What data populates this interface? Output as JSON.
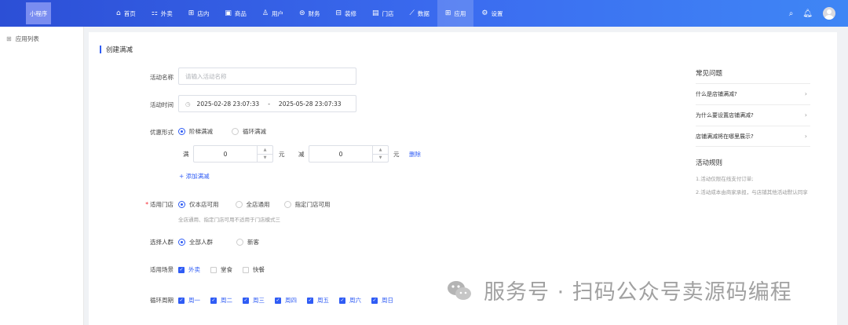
{
  "header": {
    "logo_text": "小程序",
    "nav": [
      {
        "icon": "⌂",
        "icon_name": "home-icon",
        "label": "首页",
        "active": false
      },
      {
        "icon": "⚏",
        "icon_name": "takeout-icon",
        "label": "外卖",
        "active": false
      },
      {
        "icon": "⊞",
        "icon_name": "dine-in-icon",
        "label": "店内",
        "active": false
      },
      {
        "icon": "▣",
        "icon_name": "goods-icon",
        "label": "商品",
        "active": false
      },
      {
        "icon": "♙",
        "icon_name": "user-icon",
        "label": "用户",
        "active": false
      },
      {
        "icon": "⊜",
        "icon_name": "finance-icon",
        "label": "财务",
        "active": false
      },
      {
        "icon": "⊟",
        "icon_name": "decoration-icon",
        "label": "装修",
        "active": false
      },
      {
        "icon": "▤",
        "icon_name": "store-icon",
        "label": "门店",
        "active": false
      },
      {
        "icon": "⟋",
        "icon_name": "data-icon",
        "label": "数据",
        "active": false
      },
      {
        "icon": "⊞",
        "icon_name": "apps-icon",
        "label": "应用",
        "active": true
      },
      {
        "icon": "⚙",
        "icon_name": "gear-icon",
        "label": "设置",
        "active": false
      }
    ]
  },
  "sidebar": {
    "items": [
      {
        "label": "应用列表"
      }
    ]
  },
  "form": {
    "title": "创建满减",
    "name": {
      "label": "活动名称",
      "placeholder": "请输入活动名称"
    },
    "time": {
      "label": "活动时间",
      "start": "2025-02-28 23:07:33",
      "separator": "-",
      "end": "2025-05-28 23:07:33"
    },
    "discount_form": {
      "label": "优惠形式",
      "options": [
        "阶梯满减",
        "循环满减"
      ],
      "selected": 0
    },
    "tier": {
      "full_label": "满",
      "full_value": "0",
      "unit1": "元",
      "minus_label": "减",
      "minus_value": "0",
      "unit2": "元",
      "delete_label": "删除",
      "add_label": "+ 添加满减"
    },
    "stores": {
      "label": "适用门店",
      "options": [
        "仅本店可用",
        "全店通用",
        "指定门店可用"
      ],
      "selected": 0,
      "hint": "全店通用、指定门店可用不适用于门店模式三"
    },
    "crowd": {
      "label": "选择人群",
      "options": [
        "全部人群",
        "新客"
      ],
      "selected": 0
    },
    "scenes": {
      "label": "适用场景",
      "options": [
        {
          "label": "外卖",
          "checked": true
        },
        {
          "label": "堂食",
          "checked": false
        },
        {
          "label": "快餐",
          "checked": false
        }
      ]
    },
    "cycle": {
      "label": "循环周期",
      "options": [
        {
          "label": "周一",
          "checked": true
        },
        {
          "label": "周二",
          "checked": true
        },
        {
          "label": "周三",
          "checked": true
        },
        {
          "label": "周四",
          "checked": true
        },
        {
          "label": "周五",
          "checked": true
        },
        {
          "label": "周六",
          "checked": true
        },
        {
          "label": "周日",
          "checked": true
        }
      ]
    }
  },
  "faq": {
    "title": "常见问题",
    "items": [
      "什么是店铺满减?",
      "为什么要设置店铺满减?",
      "店铺满减将在哪里展示?"
    ],
    "rules_title": "活动规则",
    "rules": [
      "1.活动仅限在线支付订单;",
      "2.活动成本由商家承担，与店铺其他活动默认同享"
    ]
  },
  "watermark": {
    "text": "服务号 · 扫码公众号卖源码编程"
  },
  "colors": {
    "primary": "#2f5cf5",
    "header_start": "#2c4fd6",
    "header_end": "#3f86f5"
  }
}
